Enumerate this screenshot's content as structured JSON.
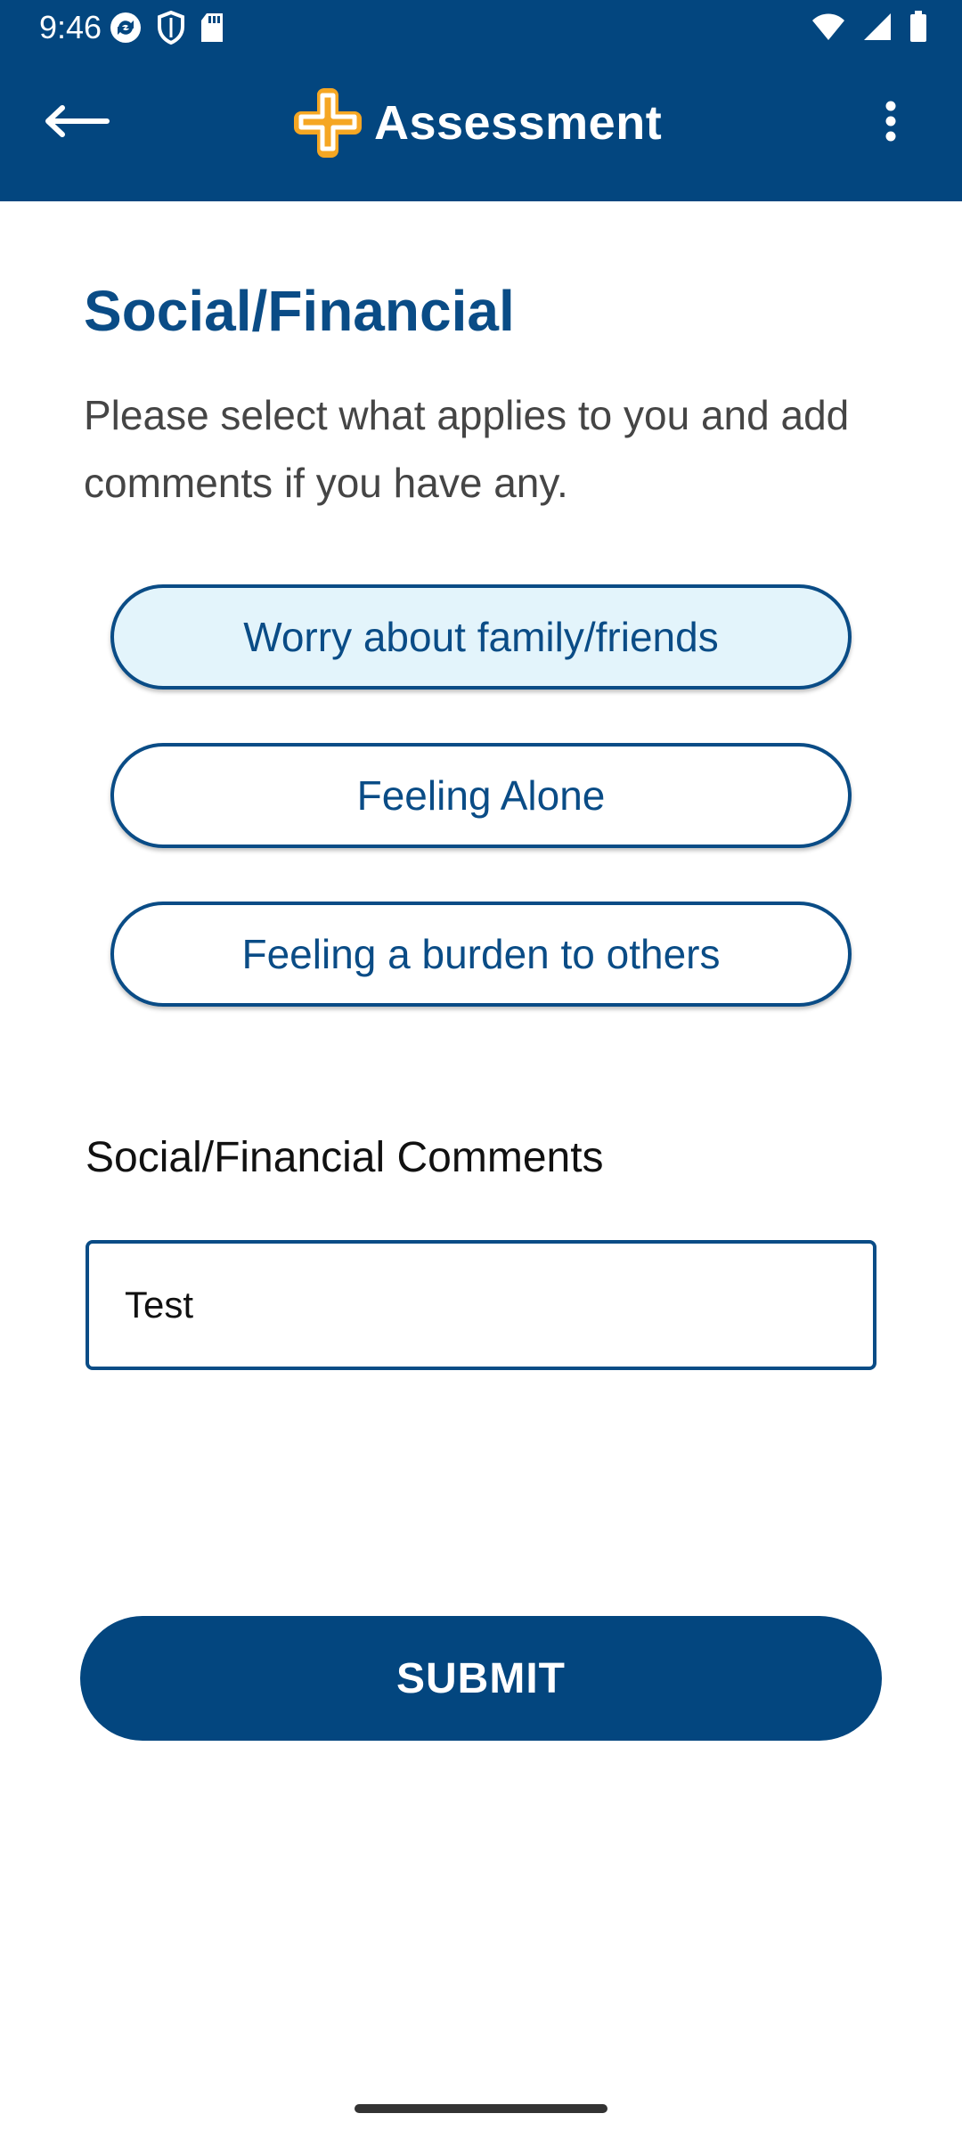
{
  "status_bar": {
    "time": "9:46"
  },
  "app_bar": {
    "title": "Assessment",
    "back_icon": "arrow-left-icon",
    "logo_icon": "cross-logo-icon",
    "menu_icon": "more-vertical-icon"
  },
  "section": {
    "title": "Social/Financial",
    "instructions": "Please select what applies to you and add comments if you have any."
  },
  "options": [
    {
      "label": "Worry about family/friends",
      "selected": true
    },
    {
      "label": "Feeling Alone",
      "selected": false
    },
    {
      "label": "Feeling a burden to others",
      "selected": false
    }
  ],
  "comments": {
    "label": "Social/Financial Comments",
    "value": "Test"
  },
  "submit": {
    "label": "SUBMIT"
  },
  "colors": {
    "primary": "#03467f",
    "accent_text": "#0a4c86",
    "selected_bg": "#e3f4fb",
    "logo_orange": "#f5a623"
  }
}
